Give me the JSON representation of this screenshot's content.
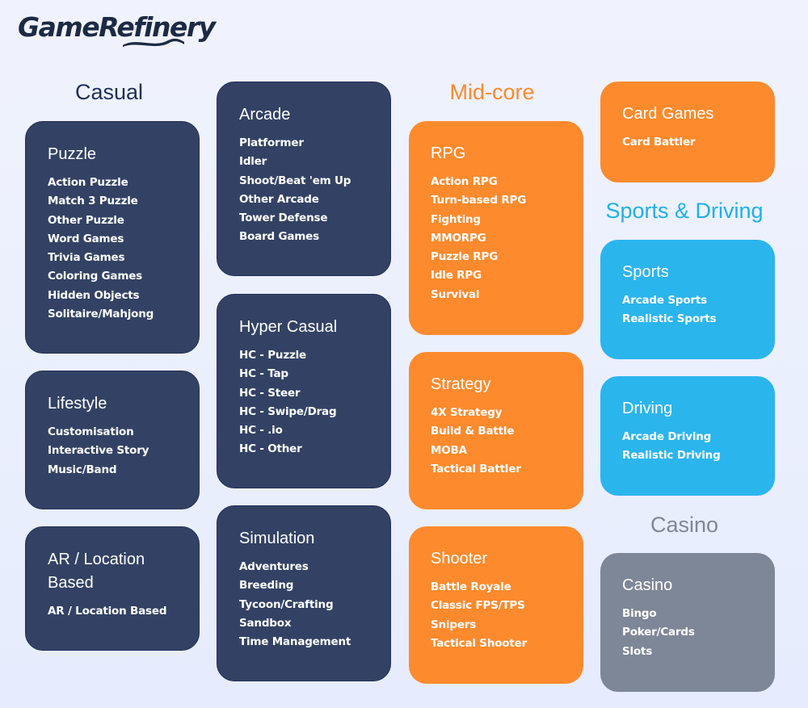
{
  "brand": {
    "logo_text": "GameRefinery"
  },
  "colors": {
    "casual": "#334264",
    "midcore": "#fd8a2d",
    "sports": "#2bb5ed",
    "casino": "#7e8797",
    "casual_heading": "#1f3058",
    "midcore_heading": "#fd8a2d",
    "sports_heading": "#1fb0ea",
    "casino_heading": "#7e8797"
  },
  "headings": {
    "casual": "Casual",
    "midcore": "Mid-core",
    "sports_driving": "Sports & Driving",
    "casino": "Casino"
  },
  "cards": {
    "puzzle": {
      "title": "Puzzle",
      "items": [
        "Action Puzzle",
        "Match 3 Puzzle",
        "Other Puzzle",
        "Word Games",
        "Trivia Games",
        "Coloring Games",
        "Hidden Objects",
        "Solitaire/Mahjong"
      ]
    },
    "lifestyle": {
      "title": "Lifestyle",
      "items": [
        "Customisation",
        "Interactive Story",
        "Music/Band"
      ]
    },
    "ar": {
      "title_line1": "AR / Location",
      "title_line2": "Based",
      "items": [
        "AR / Location Based"
      ]
    },
    "arcade": {
      "title": "Arcade",
      "items": [
        "Platformer",
        "Idler",
        "Shoot/Beat 'em Up",
        "Other Arcade",
        "Tower Defense",
        "Board Games"
      ]
    },
    "hyper_casual": {
      "title": "Hyper Casual",
      "items": [
        "HC - Puzzle",
        "HC - Tap",
        "HC - Steer",
        "HC - Swipe/Drag",
        "HC - .io",
        "HC - Other"
      ]
    },
    "simulation": {
      "title": "Simulation",
      "items": [
        "Adventures",
        "Breeding",
        "Tycoon/Crafting",
        "Sandbox",
        "Time Management"
      ]
    },
    "rpg": {
      "title": "RPG",
      "items": [
        "Action RPG",
        "Turn-based RPG",
        "Fighting",
        "MMORPG",
        "Puzzle RPG",
        "Idle RPG",
        "Survival"
      ]
    },
    "strategy": {
      "title": "Strategy",
      "items": [
        "4X Strategy",
        "Build & Battle",
        "MOBA",
        "Tactical Battler"
      ]
    },
    "shooter": {
      "title": "Shooter",
      "items": [
        "Battle Royale",
        "Classic FPS/TPS",
        "Snipers",
        "Tactical Shooter"
      ]
    },
    "card_games": {
      "title": "Card Games",
      "items": [
        "Card Battler"
      ]
    },
    "sports": {
      "title": "Sports",
      "items": [
        "Arcade Sports",
        "Realistic Sports"
      ]
    },
    "driving": {
      "title": "Driving",
      "items": [
        "Arcade Driving",
        "Realistic Driving"
      ]
    },
    "casino": {
      "title": "Casino",
      "items": [
        "Bingo",
        "Poker/Cards",
        "Slots"
      ]
    }
  }
}
